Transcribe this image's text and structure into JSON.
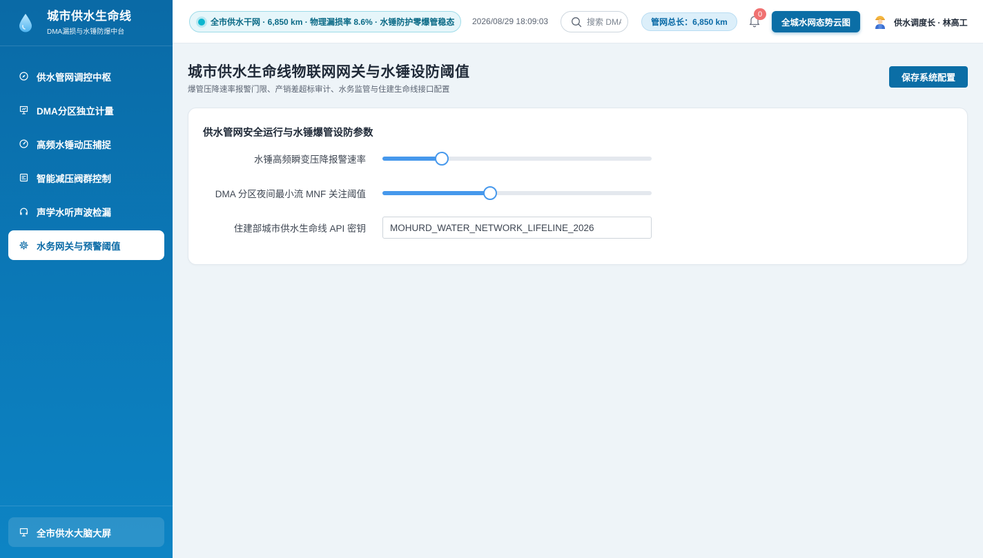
{
  "brand": {
    "title": "城市供水生命线",
    "subtitle": "DMA漏损与水锤防爆中台"
  },
  "sidebar": {
    "items": [
      {
        "label": "供水管网调控中枢",
        "icon": "compass-icon",
        "active": false
      },
      {
        "label": "DMA分区独立计量",
        "icon": "presentation-icon",
        "active": false
      },
      {
        "label": "高频水锤动压捕捉",
        "icon": "gauge-icon",
        "active": false
      },
      {
        "label": "智能减压阀群控制",
        "icon": "panel-icon",
        "active": false
      },
      {
        "label": "声学水听声波检漏",
        "icon": "headphones-icon",
        "active": false
      },
      {
        "label": "水务网关与预警阈值",
        "icon": "gear-icon",
        "active": true
      }
    ],
    "footer_label": "全市供水大脑大屏"
  },
  "header": {
    "status_text": "全市供水干网 · 6,850 km · 物理漏损率 8.6% · 水锤防护零爆管稳态",
    "datetime": "2026/08/29 18:09:03",
    "search_placeholder": "搜索 DMA",
    "length_badge": "管网总长：6,850 km",
    "notification_count": "0",
    "cloud_button": "全城水网态势云图",
    "user_name": "供水调度长 · 林高工"
  },
  "main": {
    "title": "城市供水生命线物联网网关与水锤设防阈值",
    "subtitle": "爆管压降速率报警门限、产销差超标审计、水务监管与住建生命线接口配置",
    "save_button": "保存系统配置",
    "card": {
      "title": "供水管网安全运行与水锤爆管设防参数",
      "fields": [
        {
          "label": "水锤高频瞬变压降报警速率",
          "type": "slider",
          "value_fraction": 0.22
        },
        {
          "label": "DMA 分区夜间最小流 MNF 关注阈值",
          "type": "slider",
          "value_fraction": 0.4
        },
        {
          "label": "住建部城市供水生命线 API 密钥",
          "type": "text",
          "value": "MOHURD_WATER_NETWORK_LIFELINE_2026"
        }
      ]
    }
  },
  "colors": {
    "sidebar_top": "#0a6aa6",
    "accent": "#0b6ea6",
    "slider": "#4698ec",
    "status_teal": "#0bb6cf",
    "badge_red": "#f07171"
  }
}
